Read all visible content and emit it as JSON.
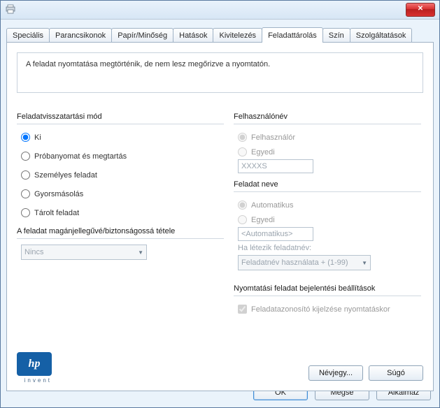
{
  "titlebar": {
    "close_label": "✕"
  },
  "tabs": [
    {
      "label": "Speciális"
    },
    {
      "label": "Parancsikonok"
    },
    {
      "label": "Papír/Minőség"
    },
    {
      "label": "Hatások"
    },
    {
      "label": "Kivitelezés"
    },
    {
      "label": "Feladattárolás"
    },
    {
      "label": "Szín"
    },
    {
      "label": "Szolgáltatások"
    }
  ],
  "active_tab_index": 5,
  "info_text": "A feladat nyomtatása megtörténik, de nem lesz megőrizve a nyomtatón.",
  "retention": {
    "heading": "Feladatvisszatartási mód",
    "options": {
      "ki": "Ki",
      "proba": "Próbanyomat és megtartás",
      "szemelyes": "Személyes feladat",
      "gyors": "Gyorsmásolás",
      "tarolt": "Tárolt feladat"
    },
    "selected": "ki"
  },
  "privacy": {
    "heading": "A feladat magánjellegűvé/biztonságossá tétele",
    "select_value": "Nincs"
  },
  "username": {
    "heading": "Felhasználónév",
    "opt_user": "Felhasználór",
    "opt_custom": "Egyedi",
    "value": "XXXXS"
  },
  "jobname": {
    "heading": "Feladat neve",
    "opt_auto": "Automatikus",
    "opt_custom": "Egyedi",
    "value": "<Automatikus>",
    "exists_label": "Ha létezik feladatnév:",
    "exists_value": "Feladatnév használata + (1-99)"
  },
  "notify": {
    "heading": "Nyomtatási feladat bejelentési beállítások",
    "checkbox": "Feladatazonosító kijelzése nyomtatáskor"
  },
  "logo": {
    "hp": "hp",
    "sub": "invent"
  },
  "buttons": {
    "about": "Névjegy...",
    "help": "Súgó",
    "ok": "OK",
    "cancel": "Mégse",
    "apply": "Alkalmaz"
  }
}
